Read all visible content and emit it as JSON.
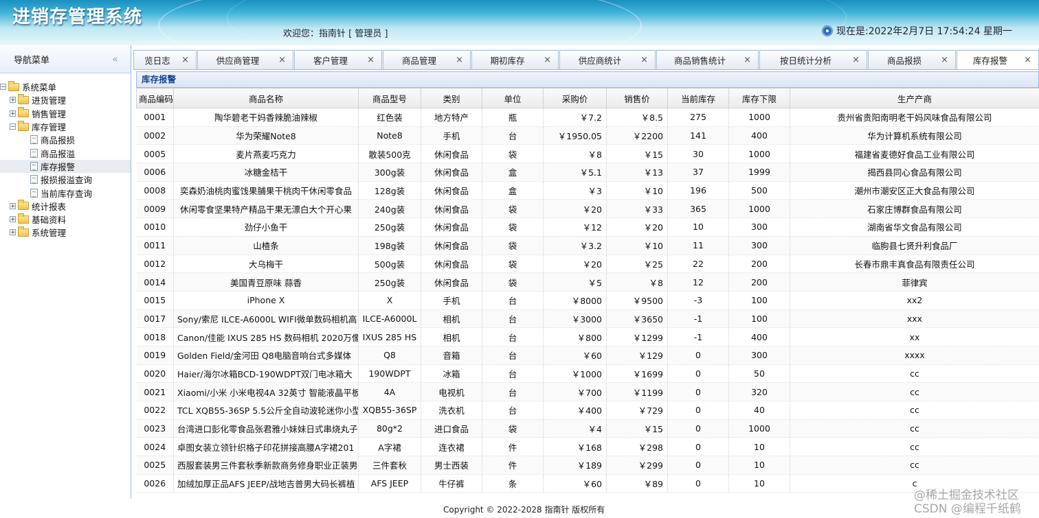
{
  "header": {
    "app_title": "进销存管理系统",
    "welcome": "欢迎您：指南针 [ 管理员 ]",
    "clock": "现在是:2022年2月7日 17:54:24 星期一"
  },
  "sidebar": {
    "title": "导航菜单",
    "collapse_icon": "«",
    "tree": [
      {
        "label": "系统菜单",
        "level": 0,
        "type": "root"
      },
      {
        "label": "进货管理",
        "level": 1,
        "type": "folder"
      },
      {
        "label": "销售管理",
        "level": 1,
        "type": "folder"
      },
      {
        "label": "库存管理",
        "level": 1,
        "type": "folder-open"
      },
      {
        "label": "商品报损",
        "level": 2,
        "type": "page"
      },
      {
        "label": "商品报溢",
        "level": 2,
        "type": "page"
      },
      {
        "label": "库存报警",
        "level": 2,
        "type": "page",
        "selected": true
      },
      {
        "label": "报损报溢查询",
        "level": 2,
        "type": "page"
      },
      {
        "label": "当前库存查询",
        "level": 2,
        "type": "page"
      },
      {
        "label": "统计报表",
        "level": 1,
        "type": "folder"
      },
      {
        "label": "基础资料",
        "level": 1,
        "type": "folder"
      },
      {
        "label": "系统管理",
        "level": 1,
        "type": "folder"
      }
    ]
  },
  "tabs": [
    {
      "label": "览日志"
    },
    {
      "label": "供应商管理"
    },
    {
      "label": "客户管理"
    },
    {
      "label": "商品管理"
    },
    {
      "label": "期初库存"
    },
    {
      "label": "供应商统计"
    },
    {
      "label": "商品销售统计"
    },
    {
      "label": "按日统计分析"
    },
    {
      "label": "商品报损"
    },
    {
      "label": "库存报警",
      "active": true
    }
  ],
  "tab_close_glyph": "×",
  "panel": {
    "title": "库存报警",
    "columns": [
      "商品编码",
      "商品名称",
      "商品型号",
      "类别",
      "单位",
      "采购价",
      "销售价",
      "当前库存",
      "库存下限",
      "生产产商"
    ],
    "rows": [
      [
        "0001",
        "陶华碧老干妈香辣脆油辣椒",
        "红色装",
        "地方特产",
        "瓶",
        "￥7.2",
        "￥8.5",
        "275",
        "1000",
        "贵州省贵阳南明老干妈风味食品有限公司"
      ],
      [
        "0002",
        "华为荣耀Note8",
        "Note8",
        "手机",
        "台",
        "￥1950.05",
        "￥2200",
        "141",
        "400",
        "华为计算机系统有限公司"
      ],
      [
        "0005",
        "麦片燕麦巧克力",
        "散装500克",
        "休闲食品",
        "袋",
        "￥8",
        "￥15",
        "30",
        "1000",
        "福建省麦德好食品工业有限公司"
      ],
      [
        "0006",
        "冰糖金桔干",
        "300g装",
        "休闲食品",
        "盒",
        "￥5.1",
        "￥13",
        "37",
        "1999",
        "揭西县同心食品有限公司"
      ],
      [
        "0008",
        "奕森奶油桃肉蜜饯果脯果干桃肉干休闲零食品",
        "128g装",
        "休闲食品",
        "盒",
        "￥3",
        "￥10",
        "196",
        "500",
        "潮州市潮安区正大食品有限公司"
      ],
      [
        "0009",
        "休闲零食坚果特产精品干果无漂白大个开心果",
        "240g装",
        "休闲食品",
        "袋",
        "￥20",
        "￥33",
        "365",
        "1000",
        "石家庄博群食品有限公司"
      ],
      [
        "0010",
        "劲仔小鱼干",
        "250g装",
        "休闲食品",
        "袋",
        "￥12",
        "￥20",
        "10",
        "300",
        "湖南省华文食品有限公司"
      ],
      [
        "0011",
        "山楂条",
        "198g装",
        "休闲食品",
        "袋",
        "￥3.2",
        "￥10",
        "11",
        "300",
        "临朐县七贤升利食品厂"
      ],
      [
        "0012",
        "大乌梅干",
        "500g装",
        "休闲食品",
        "袋",
        "￥20",
        "￥25",
        "22",
        "200",
        "长春市鼎丰真食品有限责任公司"
      ],
      [
        "0014",
        "美国青豆原味 蒜香",
        "250g装",
        "休闲食品",
        "袋",
        "￥5",
        "￥8",
        "12",
        "200",
        "菲律宾"
      ],
      [
        "0015",
        "iPhone X",
        "X",
        "手机",
        "台",
        "￥8000",
        "￥9500",
        "-3",
        "100",
        "xx2"
      ],
      [
        "0017",
        "Sony/索尼 ILCE-A6000L WIFI微单数码相机高",
        "ILCE-A6000L",
        "相机",
        "台",
        "￥3000",
        "￥3650",
        "-1",
        "100",
        "xxx"
      ],
      [
        "0018",
        "Canon/佳能 IXUS 285 HS 数码相机 2020万像",
        "IXUS 285 HS",
        "相机",
        "台",
        "￥800",
        "￥1299",
        "-1",
        "400",
        "xx"
      ],
      [
        "0019",
        "Golden Field/金河田 Q8电脑音响台式多媒体",
        "Q8",
        "音箱",
        "台",
        "￥60",
        "￥129",
        "0",
        "300",
        "xxxx"
      ],
      [
        "0020",
        "Haier/海尔冰箱BCD-190WDPT双门电冰箱大",
        "190WDPT",
        "冰箱",
        "台",
        "￥1000",
        "￥1699",
        "0",
        "50",
        "cc"
      ],
      [
        "0021",
        "Xiaomi/小米 小米电视4A 32英寸 智能液晶平板",
        "4A",
        "电视机",
        "台",
        "￥700",
        "￥1199",
        "0",
        "320",
        "cc"
      ],
      [
        "0022",
        "TCL XQB55-36SP 5.5公斤全自动波轮迷你小型",
        "XQB55-36SP",
        "洗衣机",
        "台",
        "￥400",
        "￥729",
        "0",
        "40",
        "cc"
      ],
      [
        "0023",
        "台湾进口彭化零食品张君雅小妹妹日式串烧丸子",
        "80g*2",
        "进口食品",
        "袋",
        "￥4",
        "￥15",
        "0",
        "1000",
        "cc"
      ],
      [
        "0024",
        "卓图女装立领针织格子印花拼接高腰A字裙201",
        "A字裙",
        "连衣裙",
        "件",
        "￥168",
        "￥298",
        "0",
        "10",
        "cc"
      ],
      [
        "0025",
        "西服套装男三件套秋季新款商务修身职业正装男",
        "三件套秋",
        "男士西装",
        "件",
        "￥189",
        "￥299",
        "0",
        "10",
        "cc"
      ],
      [
        "0026",
        "加绒加厚正品AFS JEEP/战地吉普男大码长裤植",
        "AFS JEEP",
        "牛仔裤",
        "条",
        "￥60",
        "￥89",
        "0",
        "10",
        "c"
      ]
    ]
  },
  "footer": {
    "copyright": "Copyright © 2022-2028 指南针 版权所有",
    "watermark_line1": "@稀土掘金技术社区",
    "watermark_line2": "CSDN @编程千纸鹤"
  }
}
